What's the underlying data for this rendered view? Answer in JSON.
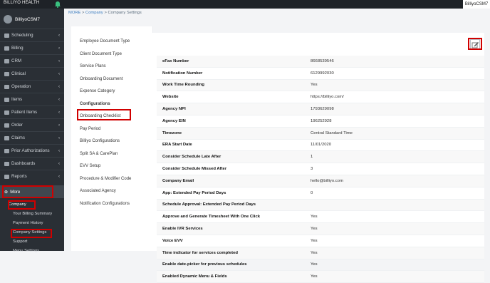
{
  "topbar": {
    "brand": "BILLIYO HEALTH",
    "user": "BilliyoCSM7"
  },
  "sidebar": {
    "profile": "BilliyoCSM7",
    "items": [
      {
        "label": "Scheduling"
      },
      {
        "label": "Billing"
      },
      {
        "label": "CRM"
      },
      {
        "label": "Clinical"
      },
      {
        "label": "Operation"
      },
      {
        "label": "Items"
      },
      {
        "label": "Patient Items"
      },
      {
        "label": "Order"
      },
      {
        "label": "Claims"
      },
      {
        "label": "Prior Authorizations"
      },
      {
        "label": "Dashboards"
      },
      {
        "label": "Reports"
      }
    ],
    "more": "More",
    "sub": [
      "Company",
      "Your Billing Summary",
      "Payment History",
      "Company Settings",
      "Support",
      "Menu Settings"
    ]
  },
  "breadcrumb": {
    "more": "MORE",
    "sep": " > ",
    "company": "Company",
    "current": "Company Settings"
  },
  "left_menu": [
    "Employee Document Type",
    "Client Document Type",
    "Service Plans",
    "Onboarding Document",
    "Expense Category",
    "Configurations",
    "Onboarding Checklist",
    "Pay Period",
    "Billiyo Configurations",
    "Split SA & CarePlan",
    "EVV Setup",
    "Procedure & Modifier Code",
    "Associated Agency",
    "Notification Configurations"
  ],
  "table": {
    "rows": [
      {
        "k": "eFax Number",
        "v": "8668539546"
      },
      {
        "k": "Notification Number",
        "v": "6129992030"
      },
      {
        "k": "Work Time Rounding",
        "v": "Yes"
      },
      {
        "k": "Website",
        "v": "https://billiyo.com/"
      },
      {
        "k": "Agency NPI",
        "v": "1793629098"
      },
      {
        "k": "Agency EIN",
        "v": "196252928"
      },
      {
        "k": "Timezone",
        "v": "Central Standard Time"
      },
      {
        "k": "ERA Start Date",
        "v": "11/01/2020"
      },
      {
        "k": "Consider Schedule Late After",
        "v": "1"
      },
      {
        "k": "Consider Schedule Missed After",
        "v": "3"
      },
      {
        "k": "Company Email",
        "v": "hello@billiyo.com"
      },
      {
        "k": "App: Extended Pay Period Days",
        "v": "0"
      },
      {
        "k": "Schedule Approval: Extended Pay Period Days",
        "v": ""
      },
      {
        "k": "Approve and Generate Timesheet With One Click",
        "v": "Yes"
      },
      {
        "k": "Enable IVR Services",
        "v": "Yes"
      },
      {
        "k": "Voice EVV",
        "v": "Yes"
      },
      {
        "k": "Time indicator for services completed",
        "v": "Yes"
      },
      {
        "k": "Enable date-picker for previous schedules",
        "v": "Yes"
      },
      {
        "k": "Enabled Dynamic Menu & Fields",
        "v": "Yes"
      }
    ]
  }
}
